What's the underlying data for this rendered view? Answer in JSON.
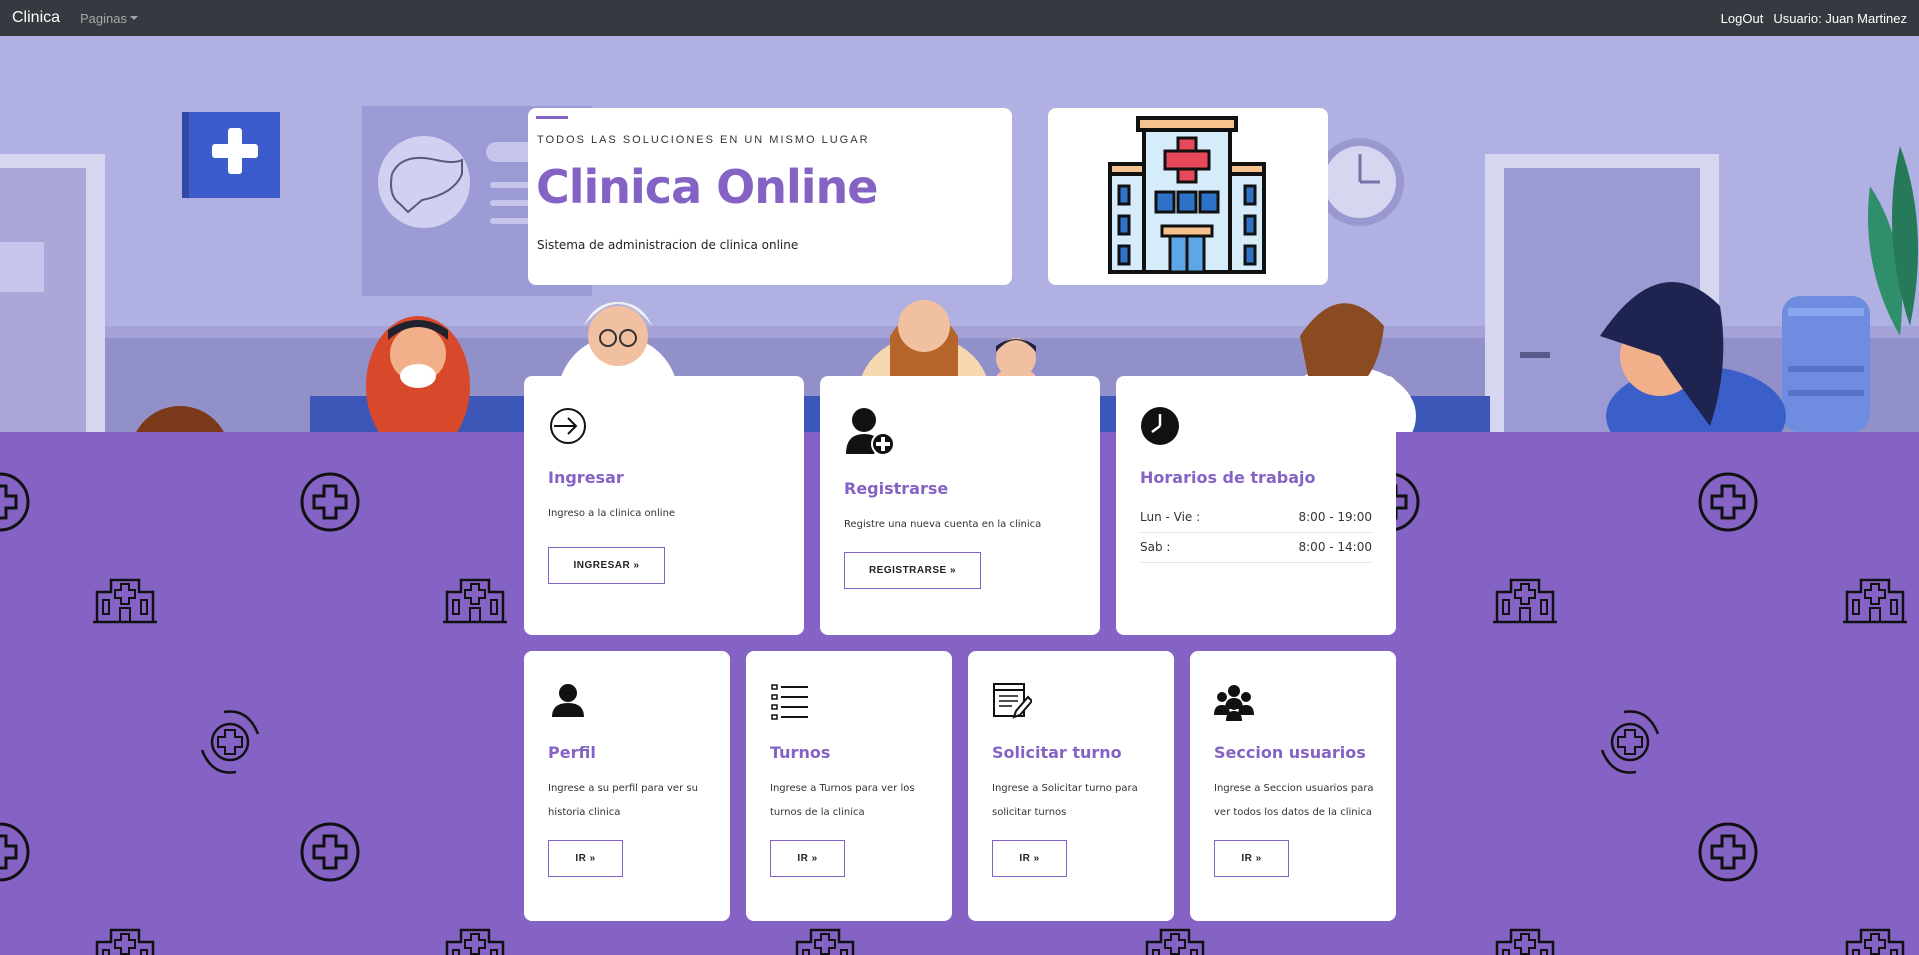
{
  "navbar": {
    "brand": "Clinica",
    "pages_menu": "Paginas",
    "logout": "LogOut",
    "user": "Usuario: Juan Martinez"
  },
  "header": {
    "eyebrow": "TODOS LAS SOLUCIONES EN UN MISMO LUGAR",
    "title": "Clinica Online",
    "subtitle": "Sistema de administracion de clinica online"
  },
  "colors": {
    "accent": "#8463c5",
    "navbar": "#343a40",
    "hero_bg": "#b1b0e3"
  },
  "cards": {
    "ingresar": {
      "icon": "login-arrow-icon",
      "title": "Ingresar",
      "desc": "Ingreso a la clinica online",
      "button": "INGRESAR »"
    },
    "registrarse": {
      "icon": "add-user-icon",
      "title": "Registrarse",
      "desc": "Registre una nueva cuenta en la clinica",
      "button": "REGISTRARSE »"
    },
    "horarios": {
      "icon": "clock-icon",
      "title": "Horarios de trabajo",
      "rows": [
        {
          "day": "Lun - Vie :",
          "hours": "8:00 - 19:00"
        },
        {
          "day": "Sab :",
          "hours": "8:00 - 14:00"
        }
      ]
    },
    "perfil": {
      "icon": "user-icon",
      "title": "Perfil",
      "desc1": "Ingrese a su perfil para ver su",
      "desc2": "historia clinica",
      "button": "IR »"
    },
    "turnos": {
      "icon": "list-icon",
      "title": "Turnos",
      "desc1": "Ingrese a Turnos para ver los",
      "desc2": "turnos de la clinica",
      "button": "IR »"
    },
    "solicitar": {
      "icon": "document-edit-icon",
      "title": "Solicitar turno",
      "desc1": "Ingrese a Solicitar turno para",
      "desc2": "solicitar turnos",
      "button": "IR »"
    },
    "usuarios": {
      "icon": "users-group-icon",
      "title": "Seccion usuarios",
      "desc1": "Ingrese a Seccion usuarios para",
      "desc2": "ver todos los datos de la clinica",
      "button": "IR »"
    }
  }
}
